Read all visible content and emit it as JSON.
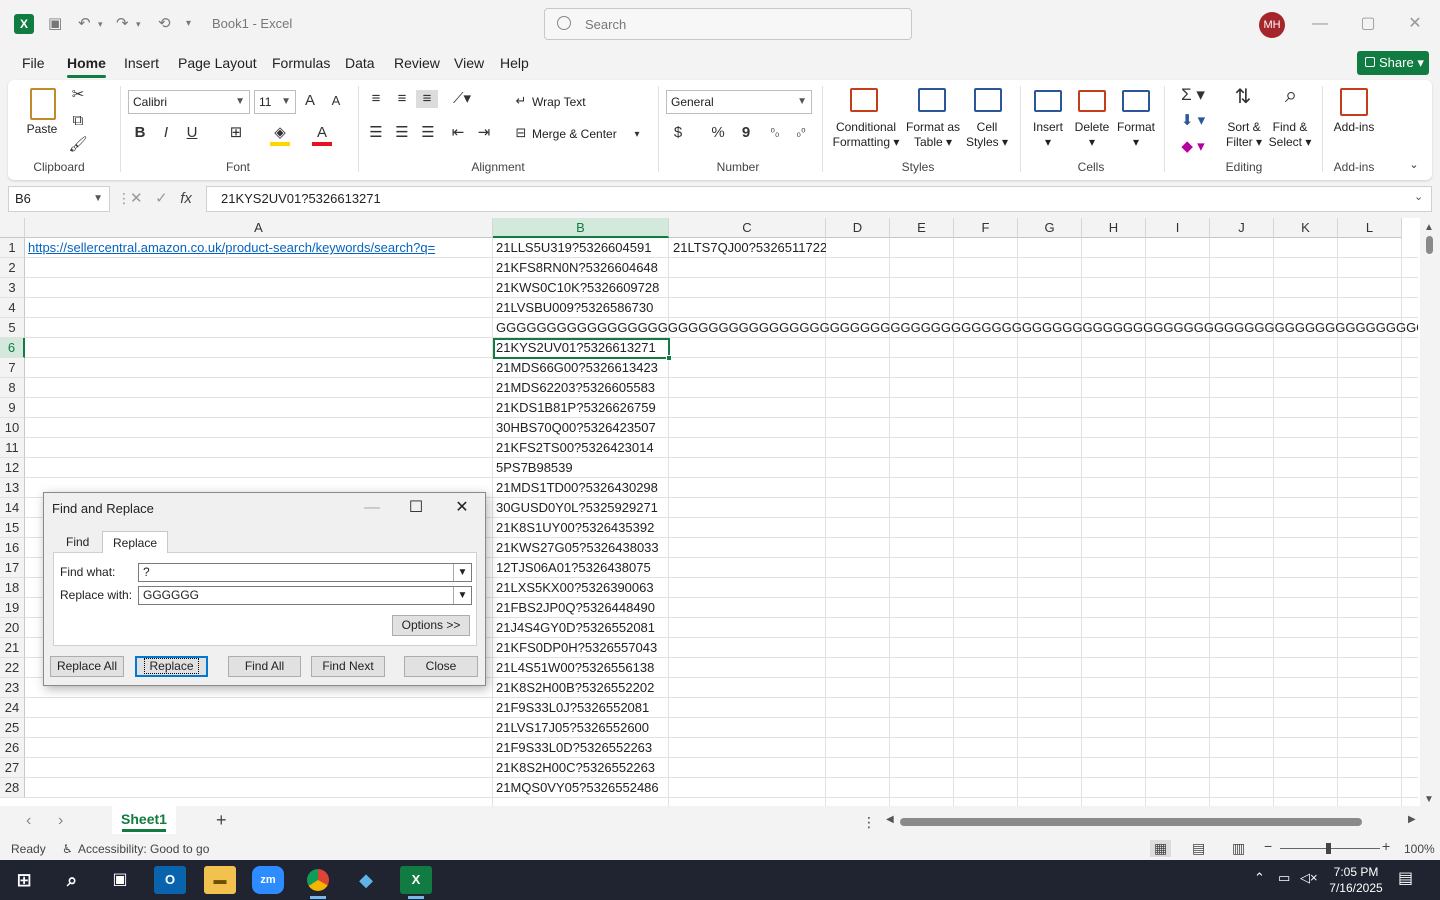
{
  "window": {
    "app_icon": "excel-icon",
    "title": "Book1  -  Excel",
    "search_placeholder": "Search",
    "avatar_initials": "MH"
  },
  "menu": {
    "tabs": [
      "File",
      "Home",
      "Insert",
      "Page Layout",
      "Formulas",
      "Data",
      "Review",
      "View",
      "Help"
    ],
    "active": "Home",
    "share_label": "Share"
  },
  "ribbon": {
    "clipboard": {
      "paste": "Paste",
      "label": "Clipboard"
    },
    "font": {
      "name": "Calibri",
      "size": "11",
      "label": "Font",
      "bold": "B",
      "italic": "I",
      "underline": "U"
    },
    "alignment": {
      "wrap_text": "Wrap Text",
      "merge_center": "Merge & Center",
      "label": "Alignment"
    },
    "number": {
      "format": "General",
      "label": "Number",
      "currency": "$",
      "percent": "%",
      "comma": "9"
    },
    "styles": {
      "conditional_1": "Conditional",
      "conditional_2": "Formatting",
      "format_table_1": "Format as",
      "format_table_2": "Table",
      "cell_styles_1": "Cell",
      "cell_styles_2": "Styles",
      "label": "Styles"
    },
    "cells": {
      "insert": "Insert",
      "delete": "Delete",
      "format": "Format",
      "label": "Cells"
    },
    "editing": {
      "sort_1": "Sort &",
      "sort_2": "Filter",
      "find_1": "Find &",
      "find_2": "Select",
      "label": "Editing"
    },
    "addins": {
      "button": "Add-ins",
      "label": "Add-ins"
    }
  },
  "formula_bar": {
    "name_box": "B6",
    "fx": "fx",
    "value": "21KYS2UV01?5326613271"
  },
  "grid": {
    "columns": [
      "A",
      "B",
      "C",
      "D",
      "E",
      "F",
      "G",
      "H",
      "I",
      "J",
      "K",
      "L"
    ],
    "rows": [
      "1",
      "2",
      "3",
      "4",
      "5",
      "6",
      "7",
      "8",
      "9",
      "10",
      "11",
      "12",
      "13",
      "14",
      "15",
      "16",
      "17",
      "18",
      "19",
      "20",
      "21",
      "22",
      "23",
      "24",
      "25",
      "26",
      "27",
      "28"
    ],
    "a1": "https://sellercentral.amazon.co.uk/product-search/keywords/search?q=",
    "c1": "21LTS7QJ00?5326511722",
    "b_values": [
      "21LLS5U319?5326604591",
      "21KFS8RN0N?5326604648",
      "21KWS0C10K?5326609728",
      "21LVSBU009?5326586730",
      "GGGGGGGGGGGGGGGGGGGGGGGGGGGGGGGGGGGGGGGGGGGGGGGGGGGGGGGGGGGGGGGGGGGGGGGGGGGGGGGGGGGGGGGGGGGGGGGGGGG",
      "21KYS2UV01?5326613271",
      "21MDS66G00?5326613423",
      "21MDS62203?5326605583",
      "21KDS1B81P?5326626759",
      "30HBS70Q00?5326423507",
      "21KFS2TS00?5326423014",
      "5PS7B98539",
      "21MDS1TD00?5326430298",
      "30GUSD0Y0L?5325929271",
      "21K8S1UY00?5326435392",
      "21KWS27G05?5326438033",
      "12TJS06A01?5326438075",
      "21LXS5KX00?5326390063",
      "21FBS2JP0Q?5326448490",
      "21J4S4GY0D?5326552081",
      "21KFS0DP0H?5326557043",
      "21L4S51W00?5326556138",
      "21K8S2H00B?5326552202",
      "21F9S33L0J?5326552081",
      "21LVS17J05?5326552600",
      "21F9S33L0D?5326552263",
      "21K8S2H00C?5326552263",
      "21MQS0VY05?5326552486"
    ]
  },
  "sheets": {
    "active": "Sheet1"
  },
  "status": {
    "ready": "Ready",
    "accessibility": "Accessibility: Good to go",
    "zoom": "100%"
  },
  "dialog": {
    "title": "Find and Replace",
    "tabs": [
      "Find",
      "Replace"
    ],
    "active_tab": "Replace",
    "find_label": "Find what:",
    "find_value": "?",
    "replace_label": "Replace with:",
    "replace_value": "GGGGGG",
    "options": "Options >>",
    "buttons": {
      "replace_all": "Replace All",
      "replace": "Replace",
      "find_all": "Find All",
      "find_next": "Find Next",
      "close": "Close"
    }
  },
  "taskbar": {
    "time": "7:05 PM",
    "date": "7/16/2025"
  },
  "colors": {
    "excel_green": "#107c41",
    "selected_header": "#d3e9db",
    "link": "#0563c1",
    "avatar": "#a4262c"
  }
}
